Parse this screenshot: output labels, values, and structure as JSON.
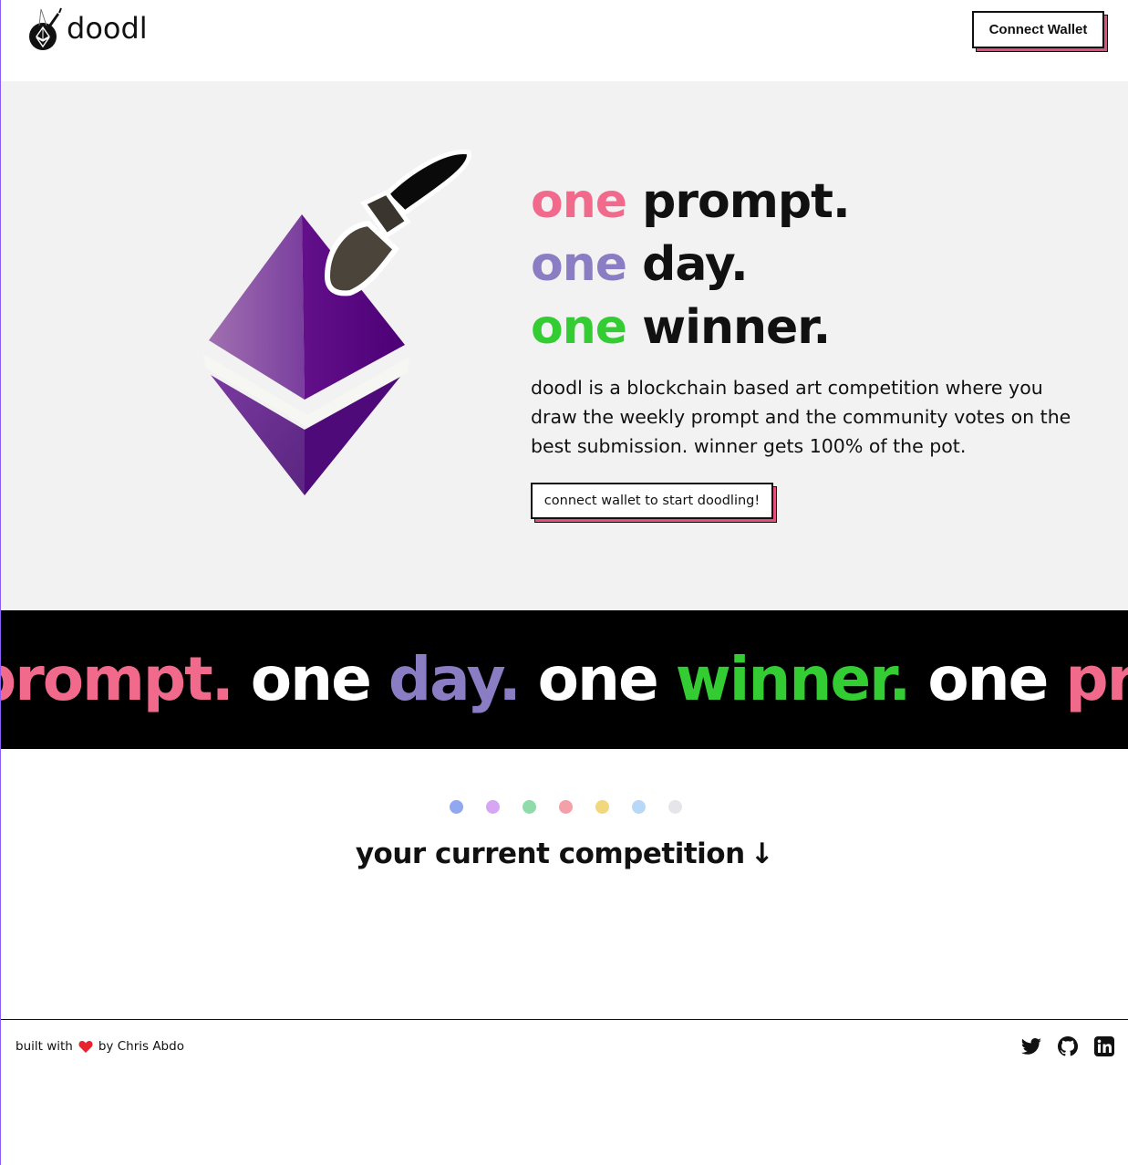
{
  "header": {
    "logo_text": "doodl",
    "connect_label": "Connect Wallet"
  },
  "hero": {
    "tagline": [
      {
        "accent": "one",
        "rest": "prompt.",
        "accent_color": "#f16a8c"
      },
      {
        "accent": "one",
        "rest": "day.",
        "accent_color": "#8a7dc3"
      },
      {
        "accent": "one",
        "rest": "winner.",
        "accent_color": "#33cc33"
      }
    ],
    "description": "doodl is a blockchain based art competition where you draw the weekly prompt and the community votes on the best submission. winner gets 100% of the pot.",
    "cta_label": "connect wallet to start doodling!"
  },
  "marquee": {
    "words": [
      "prompt.",
      "one",
      "day.",
      "one",
      "winner.",
      "one",
      "prompt."
    ]
  },
  "competition": {
    "dot_colors": [
      "#8fa8f0",
      "#d6a6f5",
      "#8fdcaa",
      "#f4a0a8",
      "#f2d77e",
      "#b8d8f8",
      "#e6e6ea"
    ],
    "title": "your current competition",
    "arrow": "↓"
  },
  "footer": {
    "built_with": "built with",
    "by": "by Chris Abdo",
    "socials": [
      "twitter-icon",
      "github-icon",
      "linkedin-icon"
    ]
  },
  "colors": {
    "pink": "#f16a8c",
    "purple": "#8a7dc3",
    "green": "#33cc33",
    "shadow": "#e0527c"
  }
}
